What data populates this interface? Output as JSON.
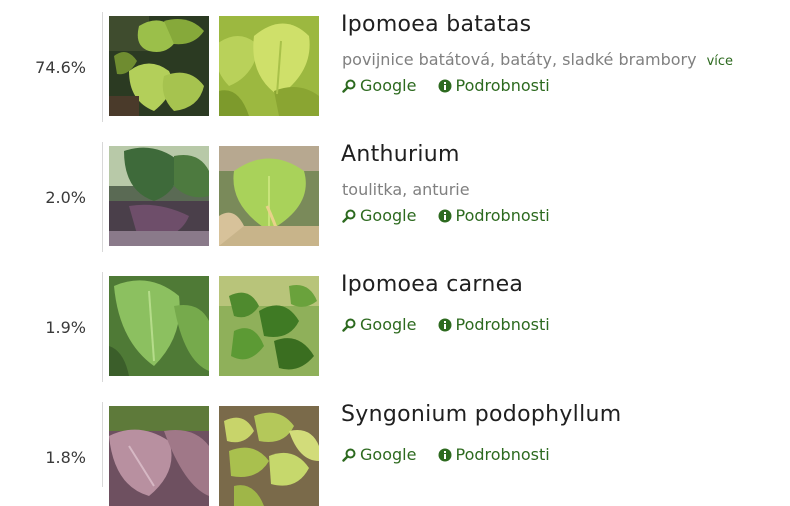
{
  "results": [
    {
      "percent": "74.6%",
      "name": "Ipomoea batatas",
      "common": "povijnice batátová, batáty, sladké brambory",
      "more_label": "více",
      "google_label": "Google",
      "details_label": "Podrobnosti"
    },
    {
      "percent": "2.0%",
      "name": "Anthurium",
      "common": "toulitka, anturie",
      "google_label": "Google",
      "details_label": "Podrobnosti"
    },
    {
      "percent": "1.9%",
      "name": "Ipomoea carnea",
      "google_label": "Google",
      "details_label": "Podrobnosti"
    },
    {
      "percent": "1.8%",
      "name": "Syngonium podophyllum",
      "google_label": "Google",
      "details_label": "Podrobnosti"
    }
  ],
  "colors": {
    "link": "#2d6a1f",
    "common_name": "#808080",
    "divider": "#d8d8d8"
  },
  "icons": {
    "google": "search-magnifier-icon",
    "details": "info-circle-icon"
  }
}
